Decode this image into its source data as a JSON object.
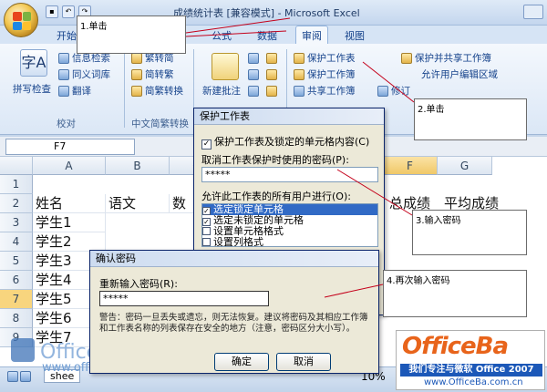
{
  "window": {
    "title": "成绩统计表 [兼容模式] - Microsoft Excel"
  },
  "qat": [
    "save",
    "undo",
    "redo"
  ],
  "tabs": [
    {
      "label": "开始",
      "active": false
    },
    {
      "label": "公式",
      "active": false
    },
    {
      "label": "数据",
      "active": false
    },
    {
      "label": "审阅",
      "active": true
    },
    {
      "label": "视图",
      "active": false
    }
  ],
  "ribbon": {
    "proofing": {
      "group": "校对",
      "spell": "拼写检查",
      "research": "信息检索",
      "thesaurus": "同义词库",
      "translate": "翻译"
    },
    "chinese": {
      "group": "中文简繁转换",
      "t2s": "繁转简",
      "s2t": "简转繁",
      "convert": "简繁转换"
    },
    "comments": {
      "new": "新建批注"
    },
    "changes": {
      "protect_sheet": "保护工作表",
      "protect_workbook": "保护工作簿",
      "share_workbook": "共享工作簿",
      "protect_share": "保护并共享工作簿",
      "allow_edit": "允许用户编辑区域",
      "track": "修订"
    }
  },
  "formula_bar": {
    "name_box": "F7"
  },
  "sheet": {
    "columns": [
      "A",
      "B",
      "C",
      "F",
      "G"
    ],
    "rows": [
      "1",
      "2",
      "3",
      "4",
      "5",
      "6",
      "7",
      "8",
      "9"
    ],
    "selected_row": "7",
    "headers": {
      "name": "姓名",
      "chinese": "语文",
      "math": "数",
      "total": "总成绩",
      "avg": "平均成绩"
    },
    "students": [
      "学生1",
      "学生2",
      "学生3",
      "学生4",
      "学生5",
      "学生6",
      "学生7"
    ]
  },
  "protect_dialog": {
    "title": "保护工作表",
    "protect_label": "保护工作表及锁定的单元格内容(C)",
    "password_label": "取消工作表保护时使用的密码(P):",
    "password_value": "*****",
    "allow_label": "允许此工作表的所有用户进行(O):",
    "options": [
      {
        "label": "选定锁定单元格",
        "checked": true,
        "selected": true
      },
      {
        "label": "选定未锁定的单元格",
        "checked": true,
        "selected": false
      },
      {
        "label": "设置单元格格式",
        "checked": false,
        "selected": false
      },
      {
        "label": "设置列格式",
        "checked": false,
        "selected": false
      }
    ]
  },
  "confirm_dialog": {
    "title": "确认密码",
    "reenter_label": "重新输入密码(R):",
    "password_value": "*****",
    "warning": "警告：密码一旦丢失或遗忘，则无法恢复。建议将密码及其相应工作簿和工作表名称的列表保存在安全的地方（注意，密码区分大小写）。",
    "ok": "确定",
    "cancel": "取消"
  },
  "callouts": [
    "1.单击",
    "2.单击",
    "3.输入密码",
    "4.再次输入密码"
  ],
  "status": {
    "zoom": "10%",
    "sheet_tab": "shee"
  },
  "watermark": {
    "brand": "Office 教程",
    "url": "www.officepp.com"
  },
  "logo": {
    "brand": "OfficeBa",
    "slogan": "我们专注与微软 Office 2007",
    "url": "www.OfficeBa.com.cn"
  },
  "colors": {
    "callout_line": "#c4001a",
    "logo_orange": "#e8641b",
    "logo_blue": "#1c58b8"
  }
}
